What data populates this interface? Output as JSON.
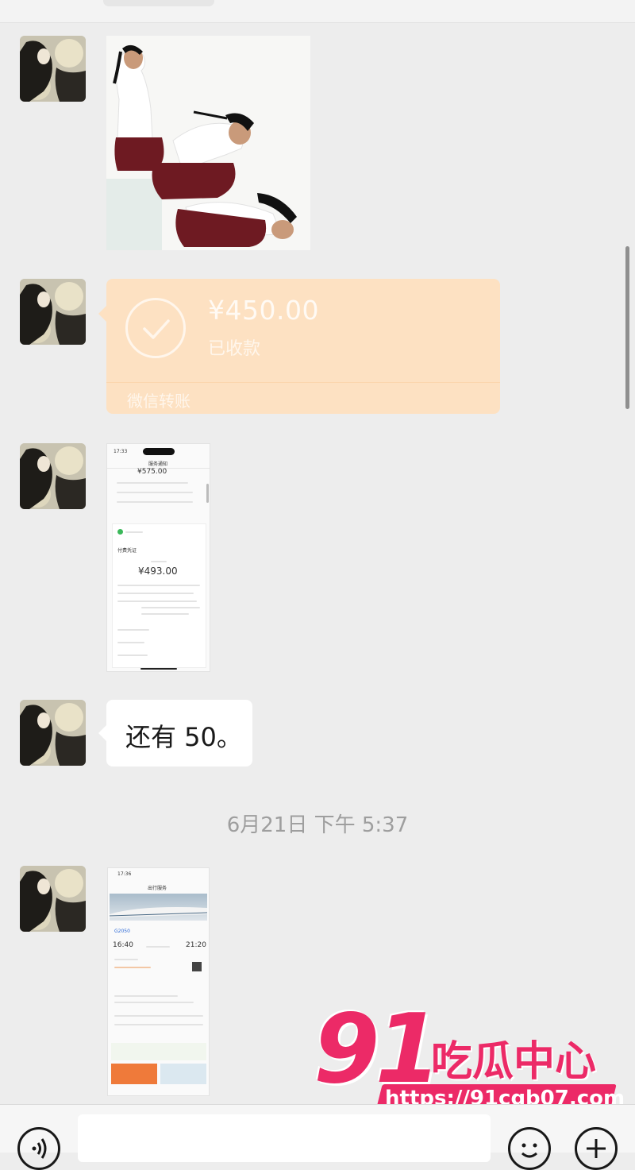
{
  "messages": {
    "transfer": {
      "amount": "¥450.00",
      "status": "已收款",
      "label": "微信转账"
    },
    "screenshot1": {
      "time": "17:33",
      "header": "服务通知",
      "top_amount": "¥575.00",
      "amount": "¥493.00",
      "title": "付费凭证"
    },
    "text_message": "还有 50。",
    "screenshot2": {
      "time": "17:36",
      "header": "出行服务",
      "train": "G2050",
      "depart_time": "16:40",
      "arrive_time": "21:20"
    }
  },
  "timestamp": "6月21日 下午 5:37",
  "watermark": {
    "number": "91",
    "name": "吃瓜中心",
    "url": "https://91cgb07.com"
  },
  "icons": {
    "avatar": "avatar-icon",
    "check": "check-circle-icon",
    "voice": "voice-icon",
    "emoji": "emoji-icon",
    "plus": "plus-icon"
  }
}
